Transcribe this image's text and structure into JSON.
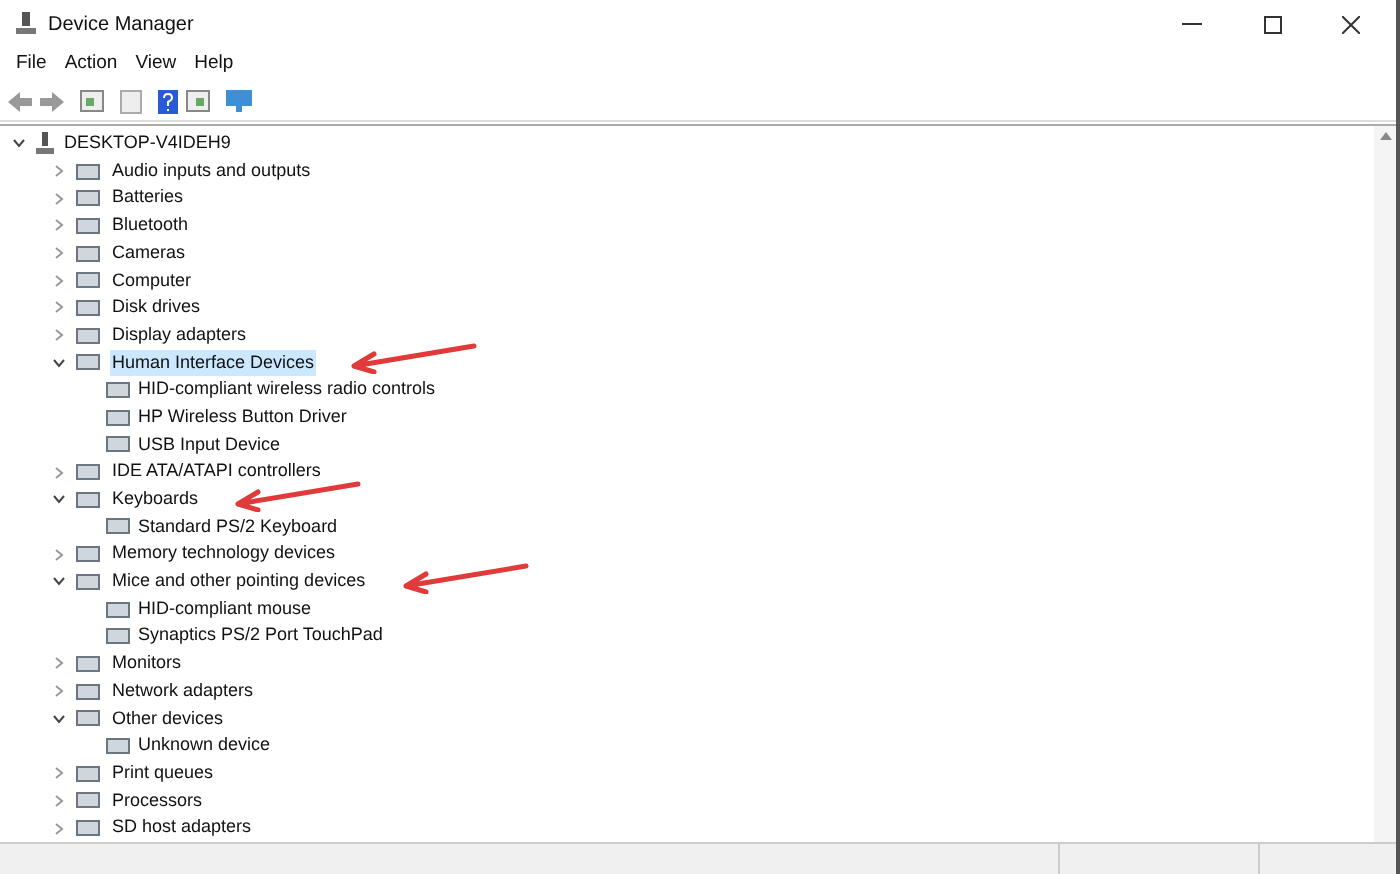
{
  "window": {
    "title": "Device Manager"
  },
  "menu": [
    "File",
    "Action",
    "View",
    "Help"
  ],
  "tree": {
    "label": "DESKTOP-V4IDEH9",
    "expanded": true,
    "children": [
      {
        "label": "Audio inputs and outputs",
        "expanded": false,
        "selected": false,
        "annotated": false
      },
      {
        "label": "Batteries",
        "expanded": false,
        "selected": false,
        "annotated": false
      },
      {
        "label": "Bluetooth",
        "expanded": false,
        "selected": false,
        "annotated": false
      },
      {
        "label": "Cameras",
        "expanded": false,
        "selected": false,
        "annotated": false
      },
      {
        "label": "Computer",
        "expanded": false,
        "selected": false,
        "annotated": false
      },
      {
        "label": "Disk drives",
        "expanded": false,
        "selected": false,
        "annotated": false
      },
      {
        "label": "Display adapters",
        "expanded": false,
        "selected": false,
        "annotated": false
      },
      {
        "label": "Human Interface Devices",
        "expanded": true,
        "selected": true,
        "annotated": true,
        "children": [
          {
            "label": "HID-compliant wireless radio controls"
          },
          {
            "label": "HP Wireless Button Driver"
          },
          {
            "label": "USB Input Device"
          }
        ]
      },
      {
        "label": "IDE ATA/ATAPI controllers",
        "expanded": false,
        "selected": false,
        "annotated": false
      },
      {
        "label": "Keyboards",
        "expanded": true,
        "selected": false,
        "annotated": true,
        "children": [
          {
            "label": "Standard PS/2 Keyboard"
          }
        ]
      },
      {
        "label": "Memory technology devices",
        "expanded": false,
        "selected": false,
        "annotated": false
      },
      {
        "label": "Mice and other pointing devices",
        "expanded": true,
        "selected": false,
        "annotated": true,
        "children": [
          {
            "label": "HID-compliant mouse"
          },
          {
            "label": "Synaptics PS/2 Port TouchPad"
          }
        ]
      },
      {
        "label": "Monitors",
        "expanded": false,
        "selected": false,
        "annotated": false
      },
      {
        "label": "Network adapters",
        "expanded": false,
        "selected": false,
        "annotated": false
      },
      {
        "label": "Other devices",
        "expanded": true,
        "selected": false,
        "annotated": false,
        "children": [
          {
            "label": "Unknown device"
          }
        ]
      },
      {
        "label": "Print queues",
        "expanded": false,
        "selected": false,
        "annotated": false
      },
      {
        "label": "Processors",
        "expanded": false,
        "selected": false,
        "annotated": false
      },
      {
        "label": "SD host adapters",
        "expanded": false,
        "selected": false,
        "annotated": false
      }
    ]
  }
}
